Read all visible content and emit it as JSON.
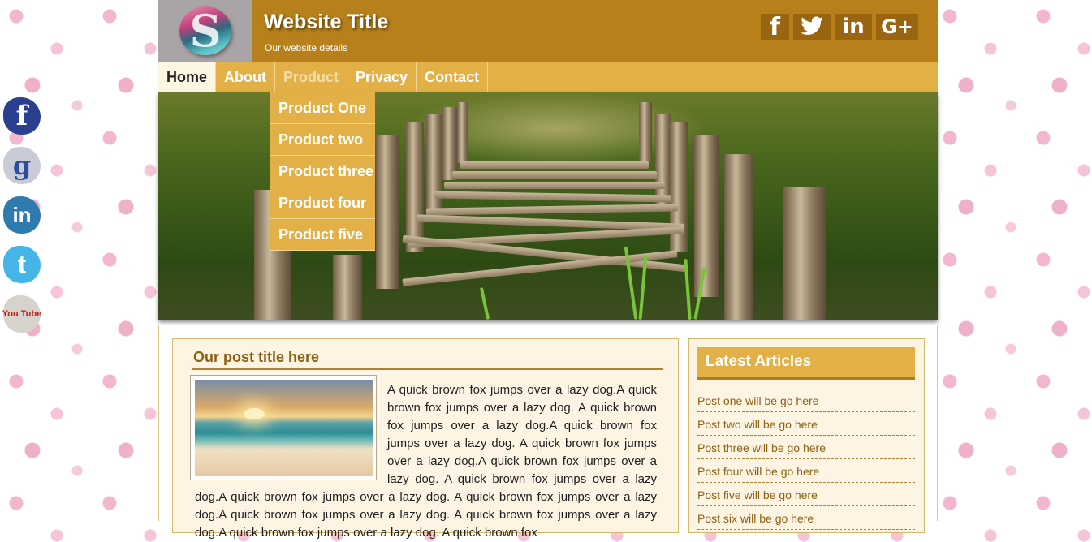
{
  "header": {
    "title": "Website Title",
    "subtitle": "Our website details",
    "social": [
      "f",
      "🐦",
      "in",
      "G+"
    ]
  },
  "nav": {
    "items": [
      "Home",
      "About",
      "Product",
      "Privacy",
      "Contact"
    ],
    "dropdown": [
      "Product One",
      "Product two",
      "Product three",
      "Product four",
      "Product five"
    ]
  },
  "post": {
    "title": "Our post title here",
    "body": "A quick brown fox jumps over a lazy dog.A quick brown fox jumps over a lazy dog. A quick brown fox jumps over a lazy dog.A quick brown fox jumps over a lazy dog. A quick brown fox jumps over a lazy dog.A quick brown fox jumps over a lazy dog. A quick brown fox jumps over a lazy dog.A quick brown fox jumps over a lazy dog. A quick brown fox jumps over a lazy dog.A quick brown fox jumps over a lazy dog. A quick brown fox jumps over a lazy dog.A quick brown fox jumps over a lazy dog. A quick brown fox"
  },
  "sidebar": {
    "title": "Latest Articles",
    "articles": [
      "Post one will be go here",
      "Post two will be go here",
      "Post three will be go here",
      "Post four will be go here",
      "Post five will be go here",
      "Post six will be go here"
    ]
  },
  "left_social": {
    "icons": [
      "facebook-icon",
      "google-icon",
      "linkedin-icon",
      "twitter-icon",
      "youtube-icon"
    ],
    "glyphs": [
      "f",
      "g",
      "in",
      "t",
      "You Tube"
    ]
  },
  "colors": {
    "header": "#b8801a",
    "nav": "#e3b047",
    "accent_text": "#8d6010"
  }
}
